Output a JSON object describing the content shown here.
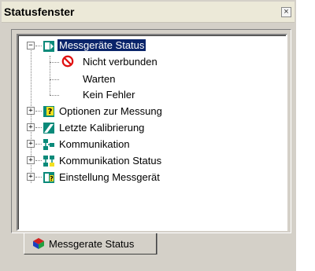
{
  "window": {
    "title": "Statusfenster",
    "close_glyph": "×"
  },
  "tree": {
    "root": {
      "label": "Messgeräte Status",
      "expander": "−",
      "icon": "device-status-icon",
      "children": [
        {
          "label": "Nicht verbunden",
          "icon": "prohibited-icon"
        },
        {
          "label": "Warten"
        },
        {
          "label": "Kein Fehler"
        }
      ]
    },
    "items": [
      {
        "label": "Optionen zur Messung",
        "expander": "+",
        "icon": "options-question-icon"
      },
      {
        "label": "Letzte Kalibrierung",
        "expander": "+",
        "icon": "calibration-icon"
      },
      {
        "label": "Kommunikation",
        "expander": "+",
        "icon": "network-icon"
      },
      {
        "label": "Kommunikation Status",
        "expander": "+",
        "icon": "network-status-icon"
      },
      {
        "label": "Einstellung Messgerät",
        "expander": "+",
        "icon": "device-settings-icon"
      }
    ]
  },
  "tabs": [
    {
      "label": "Messgerate Status",
      "icon": "cube-icon"
    }
  ],
  "colors": {
    "selection": "#0a246a",
    "icon_teal": "#0a8a7a",
    "prohibited": "#e01010"
  }
}
